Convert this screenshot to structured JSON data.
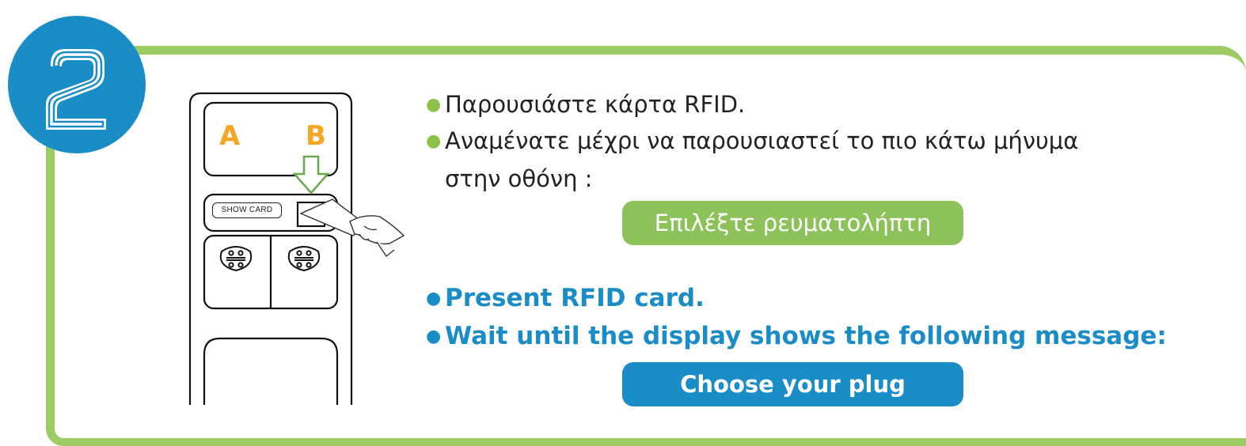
{
  "step": {
    "number": "2",
    "number_icon": "digit-2-icon",
    "circle_color": "#1a8cc6"
  },
  "illustration": {
    "label_a": "A",
    "label_b": "B",
    "show_card_label": "SHOW CARD",
    "arrow_icon": "arrow-down-icon",
    "card_icon": "rfid-card-hand-icon",
    "socket_icon": "socket-icon",
    "label_color": "#f5a623"
  },
  "instructions_gr": {
    "line1": "Παρουσιάστε κάρτα RFID.",
    "line2": "Αναμένατε μέχρι να παρουσιαστεί το πιο κάτω μήνυμα",
    "line3": "στην οθόνη :",
    "message": "Επιλέξτε ρευματολήπτη",
    "message_color": "#8dc25a"
  },
  "instructions_en": {
    "line1": "Present RFID card.",
    "line2": "Wait until the display shows the following message:",
    "message": "Choose your plug",
    "message_color": "#1a8cc6"
  },
  "colors": {
    "panel_border": "#9ccc63",
    "english_text": "#1a8cc6"
  }
}
